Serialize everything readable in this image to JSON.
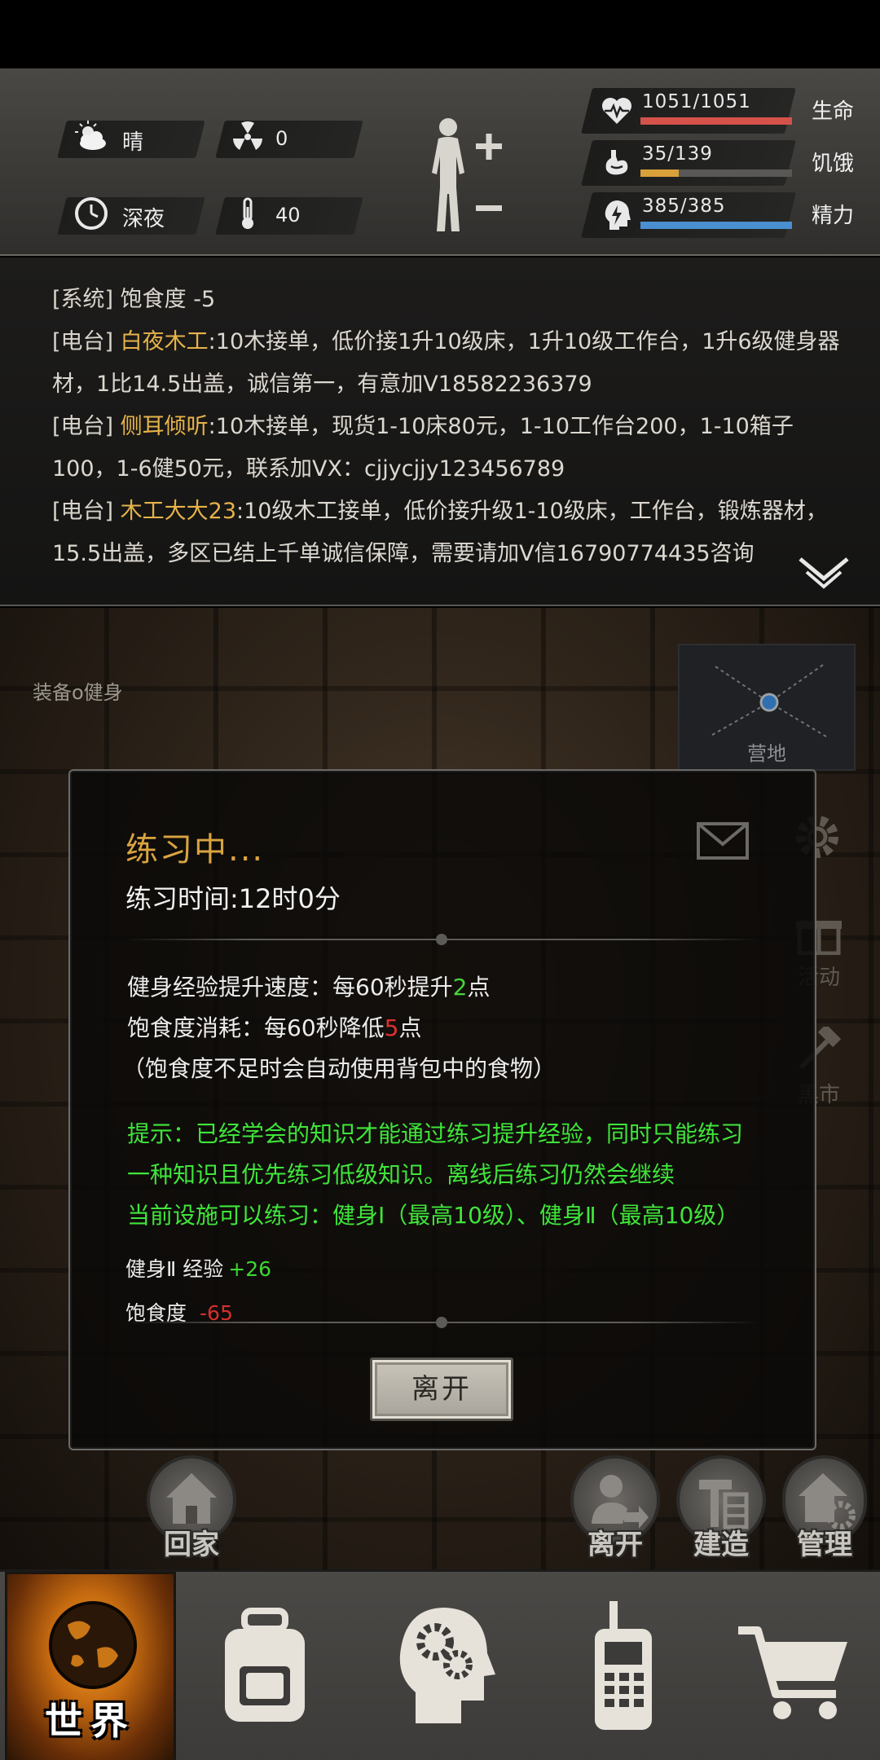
{
  "environment": {
    "weather": "晴",
    "radiation": "0",
    "time_of_day": "深夜",
    "temperature": "40"
  },
  "stats": {
    "health": {
      "value": "1051/1051",
      "label": "生命",
      "fraction": 1.0,
      "color": "#d5524a"
    },
    "hunger": {
      "value": "35/139",
      "label": "饥饿",
      "fraction": 0.252,
      "color": "#d9a13a"
    },
    "energy": {
      "value": "385/385",
      "label": "精力",
      "fraction": 1.0,
      "color": "#4a8fd0"
    }
  },
  "log": [
    {
      "tag": "[系统]",
      "sender": "",
      "text": " 饱食度 -5"
    },
    {
      "tag": "[电台]",
      "sender": " 白夜木工",
      "text": ":10木接单，低价接1升10级床，1升10级工作台，1升6级健身器材，1比14.5出盖，诚信第一，有意加V18582236379"
    },
    {
      "tag": "[电台]",
      "sender": " 侧耳倾听",
      "text": ":10木接单，现货1-10床80元，1-10工作台200，1-10箱子100，1-6健50元，联系加VX：cjjycjjy123456789"
    },
    {
      "tag": "[电台]",
      "sender": " 木工大大23",
      "text": ":10级木工接单，低价接升级1-10级床，工作台，锻炼器材，15.5出盖，多区已结上千单诚信保障，需要请加V信16790774435咨询"
    }
  ],
  "scene": {
    "location_tag": "装备o健身",
    "minimap_label": "营地",
    "side_buttons": [
      "活动",
      "黑市"
    ]
  },
  "dialog": {
    "title": "练习中...",
    "time": "练习时间:12时0分",
    "speed_prefix": "健身经验提升速度：每60秒提升",
    "speed_value": "2",
    "speed_suffix": "点",
    "hunger_prefix": "饱食度消耗：每60秒降低",
    "hunger_value": "5",
    "hunger_suffix": "点",
    "hunger_note": "（饱食度不足时会自动使用背包中的食物）",
    "tip_1": "提示：已经学会的知识才能通过练习提升经验，同时只能练习",
    "tip_2": "一种知识且优先练习低级知识。离线后练习仍然会继续",
    "tip_3": "当前设施可以练习：健身Ⅰ（最高10级）、健身Ⅱ（最高10级）",
    "gain_exp_label": "健身Ⅱ 经验",
    "gain_exp_value": "+26",
    "gain_hunger_label": "饱食度",
    "gain_hunger_value": "-65",
    "leave_button": "离开"
  },
  "actions": {
    "home": "回家",
    "leave": "离开",
    "build": "建造",
    "manage": "管理"
  },
  "nav": {
    "world": "世界",
    "icons": [
      "backpack-icon",
      "skills-head-icon",
      "radio-icon",
      "cart-icon"
    ]
  }
}
